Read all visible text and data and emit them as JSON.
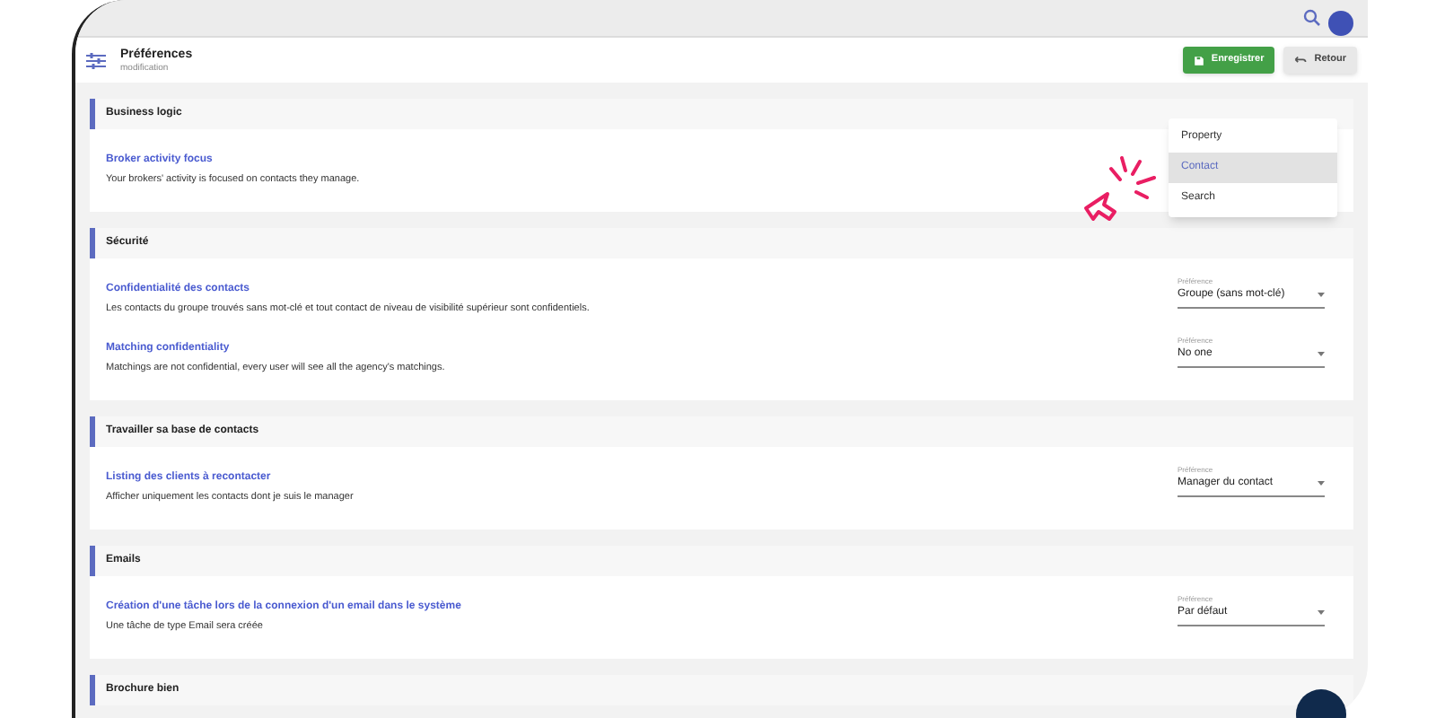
{
  "header": {
    "title": "Préférences",
    "subtitle": "modification",
    "buttons": [
      {
        "label": "Enregistrer",
        "kind": "primary"
      },
      {
        "label": "Retour",
        "kind": "secondary"
      }
    ]
  },
  "sections": [
    {
      "title": "Business logic",
      "settings": [
        {
          "title": "Broker activity focus",
          "description": "Your brokers' activity is focused on contacts they manage."
        }
      ]
    },
    {
      "title": "Sécurité",
      "settings": [
        {
          "title": "Confidentialité des contacts",
          "description": "Les contacts du groupe trouvés sans mot-clé et tout contact de niveau de visibilité supérieur sont confidentiels.",
          "select": {
            "label": "Préférence",
            "value": "Groupe (sans mot-clé)"
          }
        },
        {
          "title": "Matching confidentiality",
          "description": "Matchings are not confidential, every user will see all the agency's matchings.",
          "select": {
            "label": "Préférence",
            "value": "No one"
          }
        }
      ]
    },
    {
      "title": "Travailler sa base de contacts",
      "settings": [
        {
          "title": "Listing des clients à recontacter",
          "description": "Afficher uniquement les contacts dont je suis le manager",
          "select": {
            "label": "Préférence",
            "value": "Manager du contact"
          }
        }
      ]
    },
    {
      "title": "Emails",
      "settings": [
        {
          "title": "Création d'une tâche lors de la connexion d'un email dans le système",
          "description": "Une tâche de type Email sera créée",
          "select": {
            "label": "Préférence",
            "value": "Par défaut"
          }
        }
      ]
    },
    {
      "title": "Brochure bien"
    }
  ],
  "dropdown": {
    "items": [
      {
        "label": "Property",
        "selected": false
      },
      {
        "label": "Contact",
        "selected": true
      },
      {
        "label": "Search",
        "selected": false
      }
    ]
  }
}
